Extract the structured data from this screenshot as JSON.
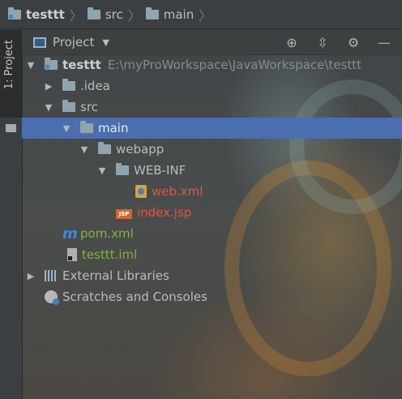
{
  "breadcrumb": [
    "testtt",
    "src",
    "main"
  ],
  "stripe": {
    "label": "1: Project"
  },
  "header": {
    "title": "Project"
  },
  "tree": {
    "root": {
      "label": "testtt",
      "path": "E:\\myProWorkspace\\JavaWorkspace\\testtt"
    },
    "idea": ".idea",
    "src": "src",
    "main": "main",
    "webapp": "webapp",
    "webinf": "WEB-INF",
    "webxml": "web.xml",
    "indexjsp": "index.jsp",
    "jsp_badge": "JSP",
    "pom": "pom.xml",
    "iml": "testtt.iml",
    "extlibs": "External Libraries",
    "scratches": "Scratches and Consoles"
  },
  "colors": {
    "selection": "#4b6eaf",
    "error_file": "#e05545",
    "vcs_added": "#7fb347"
  }
}
